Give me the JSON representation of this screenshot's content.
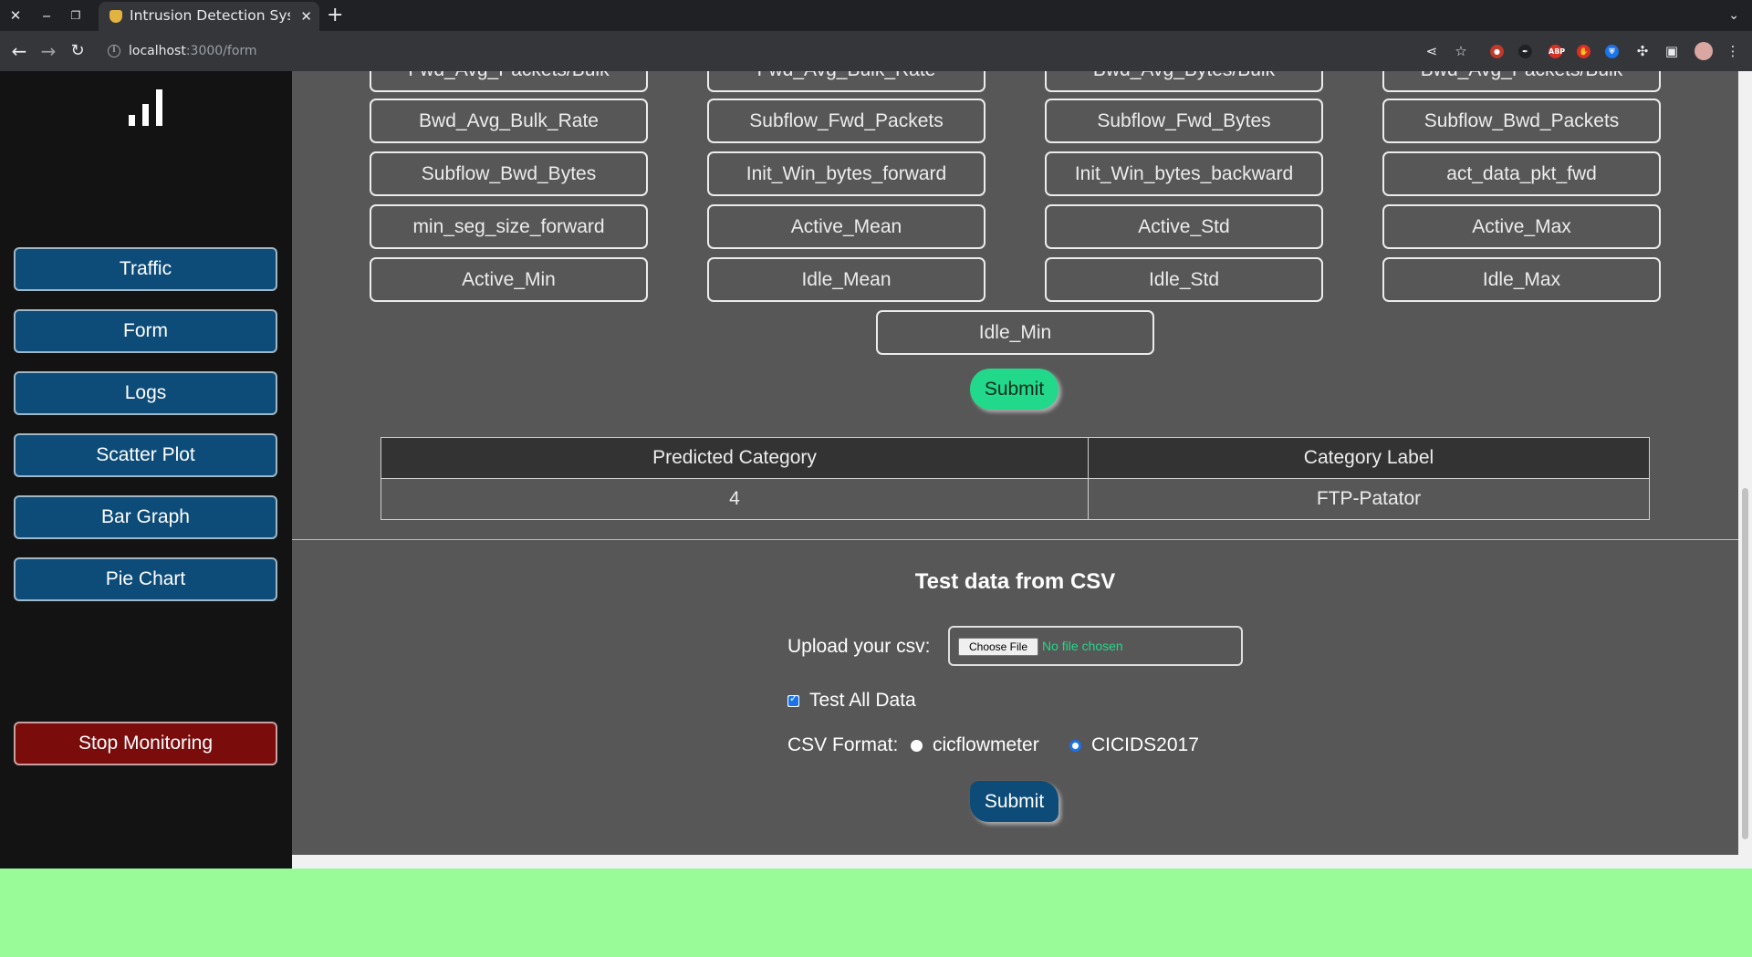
{
  "browser": {
    "tab_title": "Intrusion Detection Syst",
    "url_host": "localhost",
    "url_path": ":3000/form"
  },
  "sidebar": {
    "items": [
      {
        "label": "Traffic"
      },
      {
        "label": "Form"
      },
      {
        "label": "Logs"
      },
      {
        "label": "Scatter Plot"
      },
      {
        "label": "Bar Graph"
      },
      {
        "label": "Pie Chart"
      }
    ],
    "stop_label": "Stop Monitoring"
  },
  "features": {
    "partial_row": [
      "Fwd_Avg_Packets/Bulk",
      "Fwd_Avg_Bulk_Rate",
      "Bwd_Avg_Bytes/Bulk",
      "Bwd_Avg_Packets/Bulk"
    ],
    "row1": [
      "Bwd_Avg_Bulk_Rate",
      "Subflow_Fwd_Packets",
      "Subflow_Fwd_Bytes",
      "Subflow_Bwd_Packets"
    ],
    "row2": [
      "Subflow_Bwd_Bytes",
      "Init_Win_bytes_forward",
      "Init_Win_bytes_backward",
      "act_data_pkt_fwd"
    ],
    "row3": [
      "min_seg_size_forward",
      "Active_Mean",
      "Active_Std",
      "Active_Max"
    ],
    "row4": [
      "Active_Min",
      "Idle_Mean",
      "Idle_Std",
      "Idle_Max"
    ],
    "last": "Idle_Min"
  },
  "form": {
    "submit_label": "Submit"
  },
  "result": {
    "headers": [
      "Predicted Category",
      "Category Label"
    ],
    "row": [
      "4",
      "FTP-Patator"
    ]
  },
  "csv": {
    "title": "Test data from CSV",
    "upload_label": "Upload your csv:",
    "choose_file": "Choose File",
    "no_file": "No file chosen",
    "test_all_label": "Test All Data",
    "test_all_checked": true,
    "format_label": "CSV Format:",
    "format_options": [
      "cicflowmeter",
      "CICIDS2017"
    ],
    "format_selected": "CICIDS2017",
    "submit_label": "Submit"
  },
  "colors": {
    "sidebar_button": "#0d4b78",
    "stop_button": "#7a0c0c",
    "submit_green": "#22d88a",
    "page_background": "#575757",
    "below_page": "#98fb98"
  }
}
